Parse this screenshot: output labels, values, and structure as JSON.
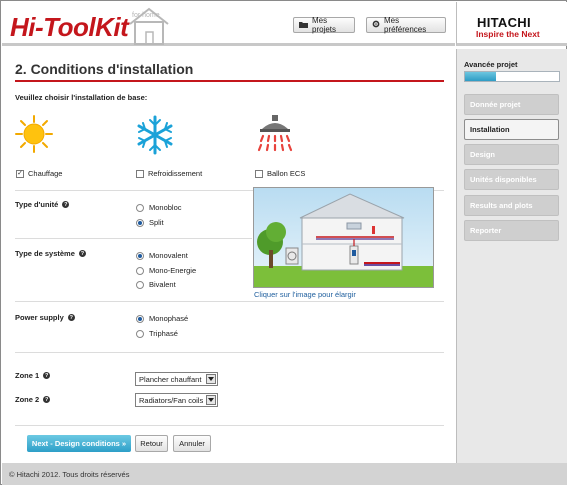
{
  "header": {
    "logo": "Hi-ToolKit",
    "logo_badge": "for home",
    "btn_projets": "Mes projets",
    "btn_prefs": "Mes préférences"
  },
  "brand": {
    "name": "HITACHI",
    "tagline": "Inspire the Next",
    "accent_color": "#c4161c",
    "primary_button_color": "#2d9fc8"
  },
  "sidebar": {
    "progress_label": "Avancée projet",
    "progress_fraction": 0.33,
    "items": [
      {
        "label": "Donnée projet",
        "active": false
      },
      {
        "label": "Installation",
        "active": true
      },
      {
        "label": "Design",
        "active": false
      },
      {
        "label": "Unités disponibles",
        "active": false
      },
      {
        "label": "Results and plots",
        "active": false
      },
      {
        "label": "Reporter",
        "active": false
      }
    ]
  },
  "main": {
    "title": "2. Conditions d'installation",
    "subtitle": "Veuillez choisir l'installation de base:",
    "installation_types": [
      {
        "label": "Chauffage",
        "icon": "sun-icon",
        "checked": true
      },
      {
        "label": "Refroidissement",
        "icon": "snowflake-icon",
        "checked": false
      },
      {
        "label": "Ballon ECS",
        "icon": "shower-icon",
        "checked": false
      }
    ],
    "type_unite": {
      "label": "Type d'unité",
      "options": [
        {
          "label": "Monobloc",
          "selected": false
        },
        {
          "label": "Split",
          "selected": true
        }
      ]
    },
    "type_systeme": {
      "label": "Type de système",
      "options": [
        {
          "label": "Monovalent",
          "selected": true
        },
        {
          "label": "Mono-Energie",
          "selected": false
        },
        {
          "label": "Bivalent",
          "selected": false
        }
      ]
    },
    "power_supply": {
      "label": "Power supply",
      "options": [
        {
          "label": "Monophasé",
          "selected": true
        },
        {
          "label": "Triphasé",
          "selected": false
        }
      ]
    },
    "enlarge_link": "Cliquer sur l'image pour élargir",
    "zone1": {
      "label": "Zone 1",
      "value": "Plancher chauffant"
    },
    "zone2": {
      "label": "Zone 2",
      "value": "Radiators/Fan coils"
    },
    "buttons": {
      "next": "Next - Design conditions »",
      "back": "Retour",
      "cancel": "Annuler"
    }
  },
  "footer": {
    "text": "© Hitachi 2012. Tous droits réservés"
  }
}
